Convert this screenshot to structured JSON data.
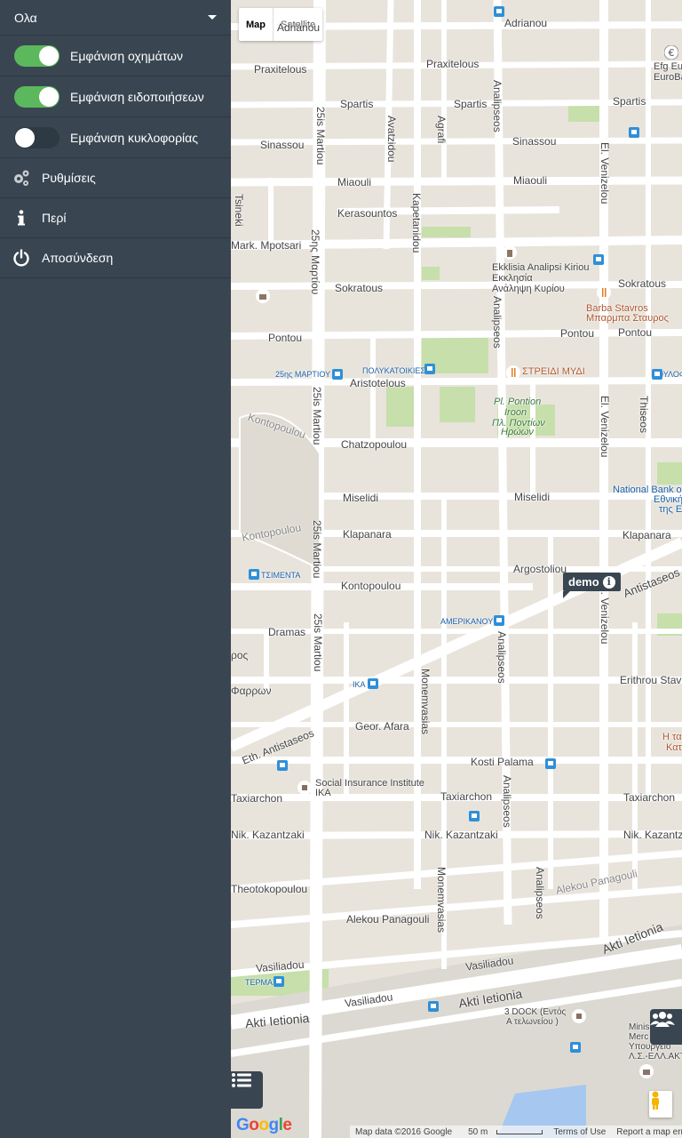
{
  "sidebar": {
    "filter": {
      "label": "Ολα"
    },
    "toggles": [
      {
        "label": "Εμφάνιση οχημάτων",
        "on": true
      },
      {
        "label": "Εμφάνιση ειδοποιήσεων",
        "on": true
      },
      {
        "label": "Εμφάνιση κυκλοφορίας",
        "on": false
      }
    ],
    "menu": [
      {
        "label": "Ρυθμίσεις",
        "icon": "gears-icon"
      },
      {
        "label": "Περί",
        "icon": "info-icon"
      },
      {
        "label": "Αποσύνδεση",
        "icon": "power-icon"
      }
    ]
  },
  "map": {
    "type_buttons": {
      "map": "Map",
      "satellite": "Satellite"
    },
    "marker": {
      "label": "demo"
    },
    "streets": {
      "adrianou_1": "Adrianou",
      "adrianou_2": "Adrianou",
      "praxitelous_1": "Praxitelous",
      "praxitelous_2": "Praxitelous",
      "spartis_1": "Spartis",
      "spartis_2": "Spartis",
      "spartis_3": "Spartis",
      "sinassou_1": "Sinassou",
      "sinassou_2": "Sinassou",
      "miaouli_1": "Miaouli",
      "miaouli_2": "Miaouli",
      "kerasountos": "Kerasountos",
      "mark_mpotsari": "Mark. Mpotsari",
      "sokratous_1": "Sokratous",
      "sokratous_2": "Sokratous",
      "pontou_1": "Pontou",
      "pontou_2": "Pontou",
      "pontou_3": "Pontou",
      "aristotelous": "Aristotelous",
      "chatzopoulou": "Chatzopoulou",
      "miselidi_1": "Miselidi",
      "miselidi_2": "Miselidi",
      "klapanara_1": "Klapanara",
      "klapanara_2": "Klapanara",
      "argostoliou": "Argostoliou",
      "kontopoulou_1": "Kontopoulou",
      "kontopoulou_2": "Kontopoulou",
      "kontopoulou_3": "Kontopoulou",
      "dramas": "Dramas",
      "farron": "Φαρρων",
      "oros": "ρος",
      "erithrou_stav": "Erithrou Stav",
      "geor_afara": "Geor. Afara",
      "eth_antistaseos": "Eth. Antistaseos",
      "antistaseos": "Antistaseos",
      "kosti_palama": "Kosti Palama",
      "taxiarchon_1": "Taxiarchon",
      "taxiarchon_2": "Taxiarchon",
      "taxiarchon_3": "Taxiarchon",
      "nik_kazantzaki_1": "Nik. Kazantzaki",
      "nik_kazantzaki_2": "Nik. Kazantzaki",
      "nik_kazantzaki_3": "Nik. Kazantzaki",
      "theotokopoulou": "Theotokopoulou",
      "alekou_panagouli_1": "Alekou Panagouli",
      "alekou_panagouli_2": "Alekou Panagouli",
      "vasiliadou_1": "Vasiliadou",
      "vasiliadou_2": "Vasiliadou",
      "vasiliadou_3": "Vasiliadou",
      "akti_ietionia_1": "Akti Ietionia",
      "akti_ietionia_2": "Akti Ietionia",
      "akti_ietionia_3": "Akti Ietionia",
      "25is_martiou_1": "25is Martiou",
      "25is_martiou_2": "25ης Μαρτίου",
      "25is_martiou_3": "25is Martiou",
      "25is_martiou_4": "25is Martiou",
      "25is_martiou_5": "25is Martiou",
      "avatzidou": "Avatzidou",
      "agrafi": "Agrafi",
      "kapetanidou": "Kapetanidou",
      "analipseos_1": "Analipseos",
      "analipseos_2": "Analipseos",
      "analipseos_3": "Analipseos",
      "analipseos_4": "Analipseos",
      "analipseos_5": "Analipseos",
      "analipseos_6": "Analipseos",
      "el_venizelou_1": "El. Venizelou",
      "el_venizelou_2": "El. Venizelou",
      "el_venizelou_3": "El. Venizelou",
      "monemvasias_1": "Monemvasias",
      "monemvasias_2": "Monemvasias",
      "tsineki": "Tsineki",
      "thiseos": "Thiseos"
    },
    "pois": {
      "efg": "Efg Eur",
      "eurobank": "EuroBa",
      "ekklisia_1": "Ekklisia Analipsi Kiriou",
      "ekklisia_2": "Εκκλησία",
      "ekklisia_3": "Ανάληψη Κυρίου",
      "barba_1": "Barba Stavros",
      "barba_2": "Μπαρμπα Σταυρος",
      "strediki": "ΣΤΡΕΙΔΙ ΜΥΔΙ",
      "stop_25is": "25ης ΜΑΡΤΙΟΥ",
      "stop_polykat": "ΠΟΛΥΚΑΤΟΙΚΙΕΣ",
      "stop_oulof": "ΟΥΛΟΦ",
      "pontion_1": "Pl. Pontion",
      "pontion_2": "Iroon",
      "pontion_3": "Πλ. Ποντίων",
      "pontion_4": "Ηρώων",
      "national_1": "National Bank o",
      "national_2": "Εθνική",
      "national_3": "της Ε",
      "stop_tsimenta": "ΤΣΙΜΕΝΤΑ",
      "stop_amerikanou": "ΑΜΕΡΙΚΑΝΟΥ",
      "stop_ika": "ΙΚΑ",
      "h_ta": "Η τα",
      "kat": "Κατ",
      "social_1": "Social Insurance Institute",
      "social_2": "IKA",
      "stop_terma": "ΤΕΡΜΑ",
      "dock_1": "3 DOCK (Εντός",
      "dock_2": "Α τελωνείου )",
      "minis_1": "Minis",
      "minis_2": "Merc",
      "minis_3": "Υπουργείο",
      "minis_4": "Λ.Σ.-ΕΛΛ.ΑΚΤ"
    },
    "footer": {
      "logo": "Google",
      "map_data": "Map data ©2016 Google",
      "scale": "50 m",
      "terms": "Terms of Use",
      "report": "Report a map error"
    }
  }
}
